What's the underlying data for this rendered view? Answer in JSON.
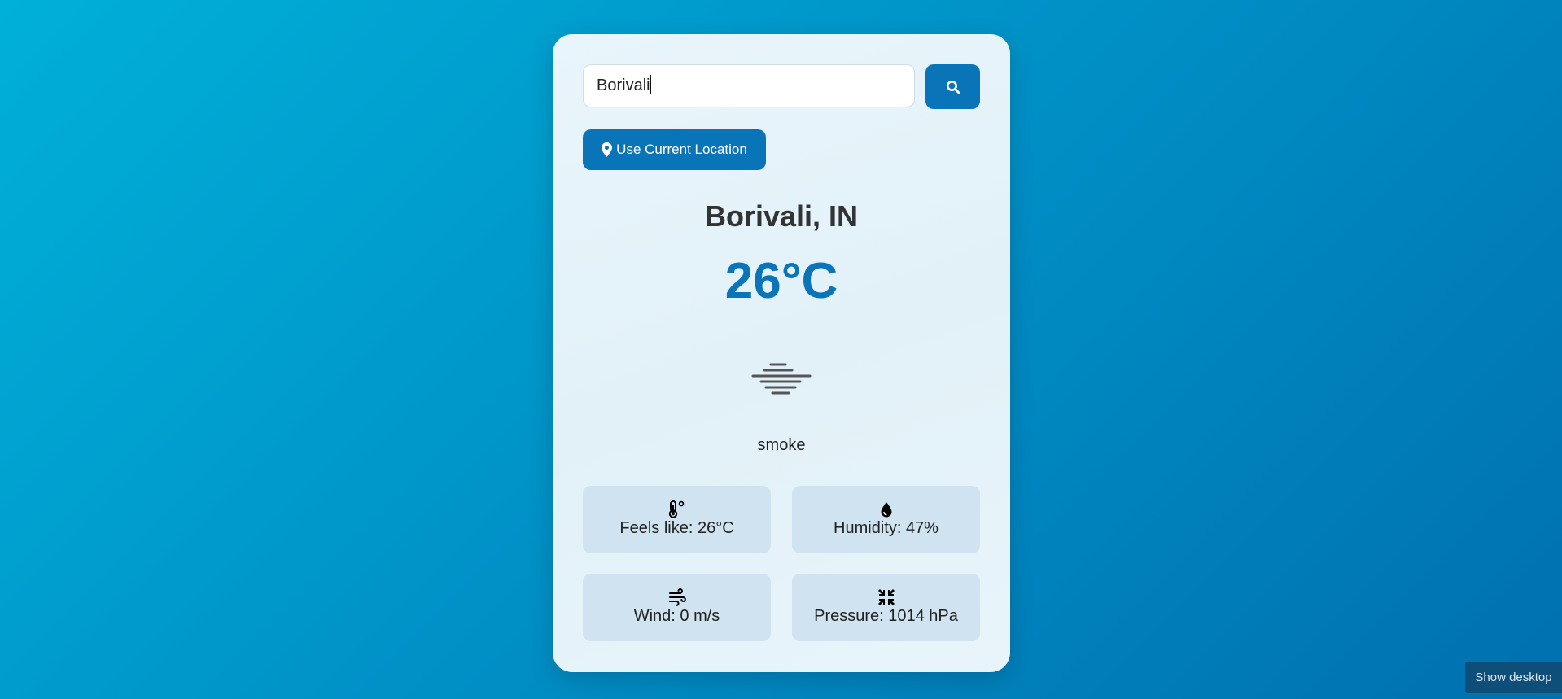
{
  "search": {
    "value": "Borivali",
    "button_icon": "search-icon"
  },
  "location_button": {
    "label": "Use Current Location",
    "icon": "map-marker-icon"
  },
  "weather": {
    "city": "Borivali, IN",
    "temperature": "26°C",
    "icon": "smoke-haze-icon",
    "description": "smoke"
  },
  "details": [
    {
      "icon": "thermometer-icon",
      "label": "Feels like: 26°C"
    },
    {
      "icon": "water-drop-icon",
      "label": "Humidity: 47%"
    },
    {
      "icon": "wind-icon",
      "label": "Wind: 0 m/s"
    },
    {
      "icon": "compress-icon",
      "label": "Pressure: 1014 hPa"
    }
  ],
  "taskbar": {
    "show_desktop": "Show desktop"
  },
  "colors": {
    "accent": "#0a74b9",
    "card_bg": "#e6f3f9",
    "detail_bg": "#cfe4f0",
    "background_start": "#00b0d8",
    "background_end": "#0070b0"
  }
}
